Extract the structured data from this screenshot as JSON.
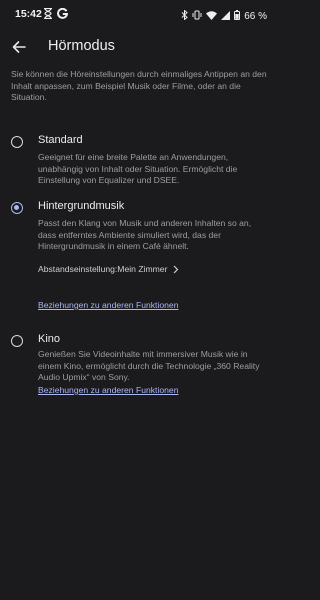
{
  "status_bar": {
    "time": "15:42",
    "left_icons": [
      "hourglass-icon",
      "g-app-icon"
    ],
    "right_icons": [
      "bluetooth-icon",
      "vibrate-icon",
      "wifi-icon",
      "signal-icon",
      "battery-icon"
    ],
    "battery": "66 %"
  },
  "header": {
    "title": "Hörmodus"
  },
  "intro": "Sie können die Höreinstellungen durch einmaliges Antippen an den Inhalt anpassen, zum Beispiel Musik oder Filme, oder an die Situation.",
  "options": [
    {
      "title": "Standard",
      "description": "Geeignet für eine breite Palette an Anwendungen, unabhängig von Inhalt oder Situation. Ermöglicht die Einstellung von Equalizer und DSEE.",
      "selected": false
    },
    {
      "title": "Hintergrundmusik",
      "description": "Passt den Klang von Musik und anderen Inhalten so an, dass entferntes Ambiente simuliert wird, das der Hintergrundmusik in einem Café ähnelt.",
      "selected": true,
      "setting_label": "Abstandseinstellung:Mein Zimmer",
      "link": "Beziehungen zu anderen Funktionen"
    },
    {
      "title": "Kino",
      "description": "Genießen Sie Videoinhalte mit immersiver Musik wie in einem Kino, ermöglicht durch die Technologie „360 Reality Audio Upmix“ von Sony.",
      "selected": false,
      "link": "Beziehungen zu anderen Funktionen"
    }
  ],
  "colors": {
    "background": "#1b1b1e",
    "accent": "#a9b7f5",
    "text_primary": "#ececef",
    "text_secondary": "#9d9da3"
  }
}
